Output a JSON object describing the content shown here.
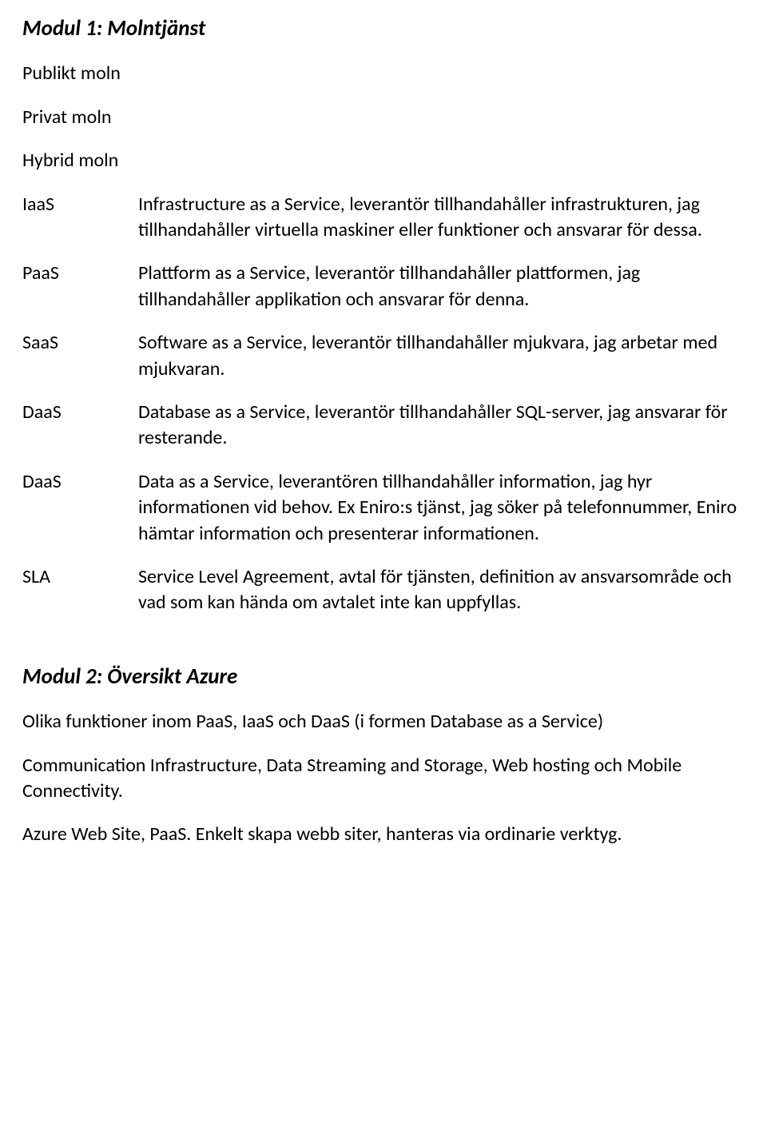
{
  "module1": {
    "title": "Modul 1: Molntjänst",
    "intro": [
      "Publikt moln",
      "Privat moln",
      "Hybrid moln"
    ],
    "defs": [
      {
        "term": "IaaS",
        "desc": "Infrastructure as a Service, leverantör tillhandahåller infrastrukturen, jag tillhandahåller virtuella maskiner eller funktioner och ansvarar för dessa."
      },
      {
        "term": "PaaS",
        "desc": "Plattform as a Service, leverantör tillhandahåller plattformen, jag tillhandahåller applikation och ansvarar för denna."
      },
      {
        "term": "SaaS",
        "desc": "Software as a Service, leverantör tillhandahåller mjukvara, jag arbetar med mjukvaran."
      },
      {
        "term": "DaaS",
        "desc": "Database as a Service, leverantör tillhandahåller SQL-server, jag ansvarar för resterande."
      },
      {
        "term": "DaaS",
        "desc": "Data as a Service, leverantören tillhandahåller information, jag hyr informationen vid behov. Ex Eniro:s tjänst, jag söker på telefonnummer, Eniro hämtar information och presenterar informationen."
      },
      {
        "term": "SLA",
        "desc": "Service Level Agreement, avtal för tjänsten, definition av ansvarsområde och vad som kan hända om avtalet inte kan uppfyllas."
      }
    ]
  },
  "module2": {
    "title": "Modul 2: Översikt Azure",
    "paras": [
      "Olika funktioner inom PaaS, IaaS och DaaS (i formen Database as a Service)",
      "Communication Infrastructure, Data Streaming and Storage, Web hosting och Mobile Connectivity.",
      "Azure Web Site, PaaS. Enkelt skapa webb siter, hanteras via ordinarie verktyg."
    ]
  }
}
